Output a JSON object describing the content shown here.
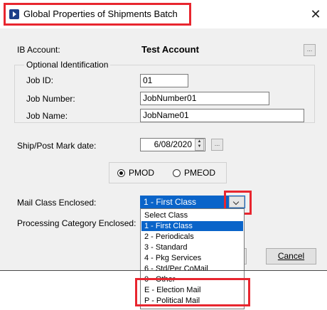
{
  "window": {
    "title": "Global Properties of Shipments Batch",
    "close_glyph": "✕"
  },
  "ib_account": {
    "label": "IB Account:",
    "value": "Test Account",
    "browse": "..."
  },
  "optional_identification": {
    "legend": "Optional Identification",
    "job_id": {
      "label": "Job ID:",
      "value": "01"
    },
    "job_number": {
      "label": "Job Number:",
      "value": "JobNumber01"
    },
    "job_name": {
      "label": "Job Name:",
      "value": "JobName01"
    }
  },
  "ship_date": {
    "label": "Ship/Post Mark date:",
    "value": "6/08/2020",
    "browse": "..."
  },
  "mark_type": {
    "options": [
      {
        "label": "PMOD",
        "checked": true
      },
      {
        "label": "PMEOD",
        "checked": false
      }
    ]
  },
  "mail_class": {
    "label": "Mail Class Enclosed:",
    "selected": "1 - First Class",
    "options": [
      "Select Class",
      "1 - First Class",
      "2 - Periodicals",
      "3 - Standard",
      "4 - Pkg Services",
      "6 - Std/Per CoMail",
      "0 - Other",
      "E - Election Mail",
      "P - Political Mail"
    ],
    "selected_index": 1
  },
  "processing_category": {
    "label": "Processing Category Enclosed:"
  },
  "buttons": {
    "cancel": "Cancel"
  },
  "colors": {
    "highlight": "#e8262f",
    "selection": "#0a64c9"
  },
  "icons": {
    "app": "app-icon",
    "dropdown": "chevron-down-icon",
    "spin": "spin-arrows-icon"
  }
}
